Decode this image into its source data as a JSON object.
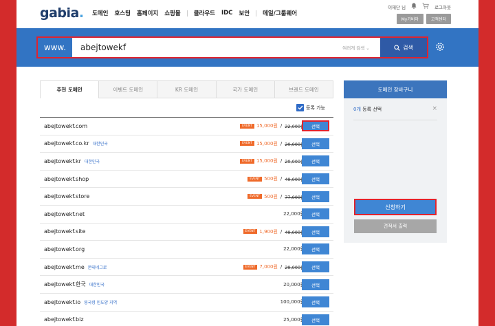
{
  "header": {
    "logo": "gabia",
    "logo_dot": ".",
    "nav": [
      "도메인",
      "호스팅",
      "홈페이지",
      "쇼핑몰",
      "클라우드",
      "IDC",
      "보안",
      "메일/그룹웨어"
    ],
    "user": "이재단 님",
    "logout": "로그아웃",
    "mygabia": "My가비아",
    "support": "고객센터"
  },
  "search": {
    "prefix": "www.",
    "query": "abejtowekf",
    "multi_label": "여러개 검색 ⌄",
    "button": "검색"
  },
  "tabs": [
    "추천 도메인",
    "이벤트 도메인",
    "KR 도메인",
    "국가 도메인",
    "브랜드 도메인"
  ],
  "available_label": "등록 가능",
  "select_label": "선택",
  "event_label": "EVENT",
  "results": [
    {
      "domain": "abejtowekf.com",
      "tag": "",
      "event": true,
      "price": "15,000원",
      "original": "22,000원"
    },
    {
      "domain": "abejtowekf.co.kr",
      "tag": "대한민국",
      "event": true,
      "price": "15,000원",
      "original": "20,000원"
    },
    {
      "domain": "abejtowekf.kr",
      "tag": "대한민국",
      "event": true,
      "price": "15,000원",
      "original": "20,000원"
    },
    {
      "domain": "abejtowekf.shop",
      "tag": "",
      "event": true,
      "price": "500원",
      "original": "49,000원"
    },
    {
      "domain": "abejtowekf.store",
      "tag": "",
      "event": true,
      "price": "500원",
      "original": "77,000원"
    },
    {
      "domain": "abejtowekf.net",
      "tag": "",
      "event": false,
      "price": "22,000원",
      "original": ""
    },
    {
      "domain": "abejtowekf.site",
      "tag": "",
      "event": true,
      "price": "1,900원",
      "original": "49,000원"
    },
    {
      "domain": "abejtowekf.org",
      "tag": "",
      "event": false,
      "price": "22,000원",
      "original": ""
    },
    {
      "domain": "abejtowekf.me",
      "tag": "몬테네그로",
      "event": true,
      "price": "7,000원",
      "original": "29,000원"
    },
    {
      "domain": "abejtowekf.한국",
      "tag": "대한민국",
      "event": false,
      "price": "20,000원",
      "original": ""
    },
    {
      "domain": "abejtowekf.io",
      "tag": "영국령 인도양 지역",
      "event": false,
      "price": "100,000원",
      "original": ""
    },
    {
      "domain": "abejtowekf.biz",
      "tag": "",
      "event": false,
      "price": "25,000원",
      "original": ""
    }
  ],
  "cart": {
    "title": "도메인 장바구니",
    "count": "0개",
    "count_suffix": " 등록 선택",
    "apply": "신청하기",
    "quote": "견적서 출력"
  },
  "colors": {
    "brand_blue": "#3274c3",
    "accent_orange": "#ef6a2a",
    "highlight_red": "#e0232d"
  }
}
